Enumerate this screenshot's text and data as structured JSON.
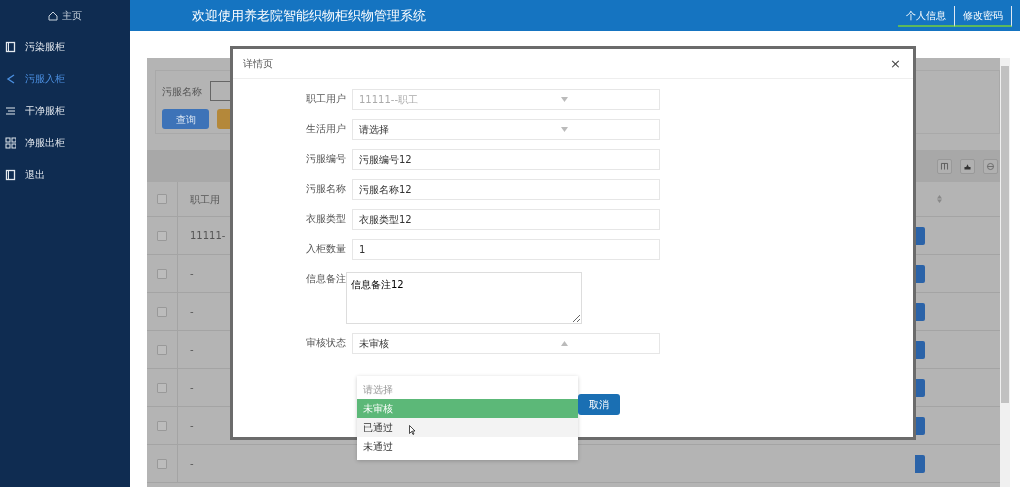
{
  "sidebar": {
    "home": "主页",
    "items": [
      {
        "label": "污染服柜",
        "selected": false
      },
      {
        "label": "污服入柜",
        "selected": true
      },
      {
        "label": "干净服柜",
        "selected": false
      },
      {
        "label": "净服出柜",
        "selected": false
      },
      {
        "label": "退出",
        "selected": false
      }
    ]
  },
  "header": {
    "title": "欢迎使用养老院智能织物柜织物管理系统",
    "links": [
      "个人信息",
      "修改密码"
    ]
  },
  "search": {
    "label": "污服名称",
    "buttons": [
      {
        "kind": "query",
        "label": "查询"
      },
      {
        "kind": "other"
      }
    ]
  },
  "table": {
    "columns": [
      "职工用"
    ],
    "all_checked": false,
    "rows": [
      {
        "checked": false,
        "cells": [
          "11111-"
        ]
      },
      {
        "checked": false,
        "cells": [
          "-"
        ]
      },
      {
        "checked": false,
        "cells": [
          "-"
        ]
      },
      {
        "checked": false,
        "cells": [
          "-"
        ]
      },
      {
        "checked": false,
        "cells": [
          "-"
        ]
      },
      {
        "checked": false,
        "cells": [
          "-"
        ]
      },
      {
        "checked": false,
        "cells": [
          "-"
        ]
      }
    ]
  },
  "dialog": {
    "title": "详情页",
    "close": "×",
    "fields": [
      {
        "kind": "select",
        "label": "职工用户",
        "value": "11111--职工",
        "disabled": true,
        "expanded": false
      },
      {
        "kind": "select",
        "label": "生活用户",
        "value": "请选择",
        "disabled": false,
        "expanded": false
      },
      {
        "kind": "input",
        "label": "污服编号",
        "value": "污服编号12"
      },
      {
        "kind": "input",
        "label": "污服名称",
        "value": "污服名称12"
      },
      {
        "kind": "input",
        "label": "衣服类型",
        "value": "衣服类型12"
      },
      {
        "kind": "input",
        "label": "入柜数量",
        "value": "1"
      },
      {
        "kind": "textarea",
        "label": "信息备注",
        "value": "信息备注12"
      },
      {
        "kind": "select",
        "label": "审核状态",
        "value": "未审核",
        "disabled": false,
        "expanded": true,
        "options": [
          {
            "label": "请选择",
            "disabled": true,
            "selected": false,
            "hovered": false
          },
          {
            "label": "未审核",
            "disabled": false,
            "selected": true,
            "hovered": false
          },
          {
            "label": "已通过",
            "disabled": false,
            "selected": false,
            "hovered": true
          },
          {
            "label": "未通过",
            "disabled": false,
            "selected": false,
            "hovered": false
          }
        ]
      }
    ],
    "buttons": [
      "取消"
    ]
  }
}
